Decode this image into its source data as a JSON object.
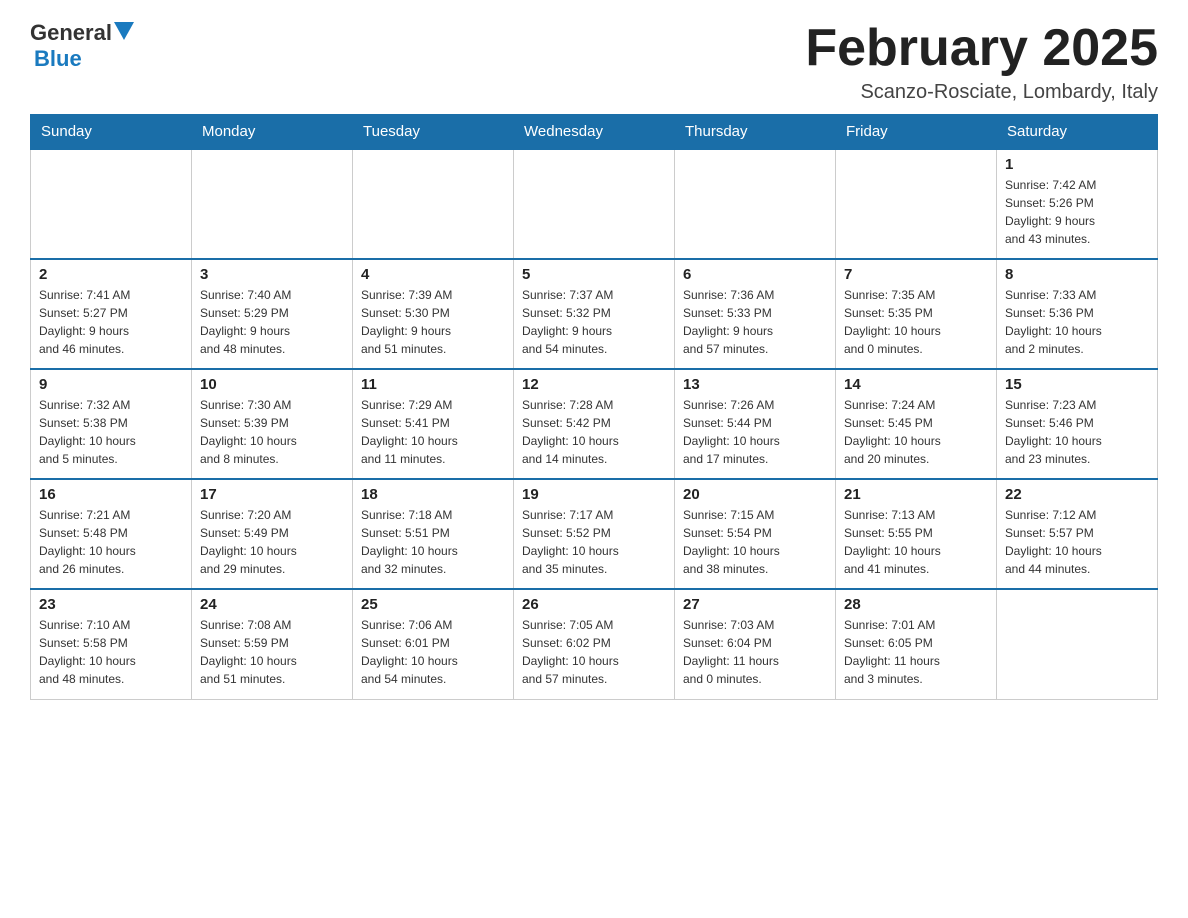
{
  "header": {
    "logo_general": "General",
    "logo_blue": "Blue",
    "month_title": "February 2025",
    "location": "Scanzo-Rosciate, Lombardy, Italy"
  },
  "days_of_week": [
    "Sunday",
    "Monday",
    "Tuesday",
    "Wednesday",
    "Thursday",
    "Friday",
    "Saturday"
  ],
  "weeks": [
    [
      {
        "day": "",
        "info": ""
      },
      {
        "day": "",
        "info": ""
      },
      {
        "day": "",
        "info": ""
      },
      {
        "day": "",
        "info": ""
      },
      {
        "day": "",
        "info": ""
      },
      {
        "day": "",
        "info": ""
      },
      {
        "day": "1",
        "info": "Sunrise: 7:42 AM\nSunset: 5:26 PM\nDaylight: 9 hours\nand 43 minutes."
      }
    ],
    [
      {
        "day": "2",
        "info": "Sunrise: 7:41 AM\nSunset: 5:27 PM\nDaylight: 9 hours\nand 46 minutes."
      },
      {
        "day": "3",
        "info": "Sunrise: 7:40 AM\nSunset: 5:29 PM\nDaylight: 9 hours\nand 48 minutes."
      },
      {
        "day": "4",
        "info": "Sunrise: 7:39 AM\nSunset: 5:30 PM\nDaylight: 9 hours\nand 51 minutes."
      },
      {
        "day": "5",
        "info": "Sunrise: 7:37 AM\nSunset: 5:32 PM\nDaylight: 9 hours\nand 54 minutes."
      },
      {
        "day": "6",
        "info": "Sunrise: 7:36 AM\nSunset: 5:33 PM\nDaylight: 9 hours\nand 57 minutes."
      },
      {
        "day": "7",
        "info": "Sunrise: 7:35 AM\nSunset: 5:35 PM\nDaylight: 10 hours\nand 0 minutes."
      },
      {
        "day": "8",
        "info": "Sunrise: 7:33 AM\nSunset: 5:36 PM\nDaylight: 10 hours\nand 2 minutes."
      }
    ],
    [
      {
        "day": "9",
        "info": "Sunrise: 7:32 AM\nSunset: 5:38 PM\nDaylight: 10 hours\nand 5 minutes."
      },
      {
        "day": "10",
        "info": "Sunrise: 7:30 AM\nSunset: 5:39 PM\nDaylight: 10 hours\nand 8 minutes."
      },
      {
        "day": "11",
        "info": "Sunrise: 7:29 AM\nSunset: 5:41 PM\nDaylight: 10 hours\nand 11 minutes."
      },
      {
        "day": "12",
        "info": "Sunrise: 7:28 AM\nSunset: 5:42 PM\nDaylight: 10 hours\nand 14 minutes."
      },
      {
        "day": "13",
        "info": "Sunrise: 7:26 AM\nSunset: 5:44 PM\nDaylight: 10 hours\nand 17 minutes."
      },
      {
        "day": "14",
        "info": "Sunrise: 7:24 AM\nSunset: 5:45 PM\nDaylight: 10 hours\nand 20 minutes."
      },
      {
        "day": "15",
        "info": "Sunrise: 7:23 AM\nSunset: 5:46 PM\nDaylight: 10 hours\nand 23 minutes."
      }
    ],
    [
      {
        "day": "16",
        "info": "Sunrise: 7:21 AM\nSunset: 5:48 PM\nDaylight: 10 hours\nand 26 minutes."
      },
      {
        "day": "17",
        "info": "Sunrise: 7:20 AM\nSunset: 5:49 PM\nDaylight: 10 hours\nand 29 minutes."
      },
      {
        "day": "18",
        "info": "Sunrise: 7:18 AM\nSunset: 5:51 PM\nDaylight: 10 hours\nand 32 minutes."
      },
      {
        "day": "19",
        "info": "Sunrise: 7:17 AM\nSunset: 5:52 PM\nDaylight: 10 hours\nand 35 minutes."
      },
      {
        "day": "20",
        "info": "Sunrise: 7:15 AM\nSunset: 5:54 PM\nDaylight: 10 hours\nand 38 minutes."
      },
      {
        "day": "21",
        "info": "Sunrise: 7:13 AM\nSunset: 5:55 PM\nDaylight: 10 hours\nand 41 minutes."
      },
      {
        "day": "22",
        "info": "Sunrise: 7:12 AM\nSunset: 5:57 PM\nDaylight: 10 hours\nand 44 minutes."
      }
    ],
    [
      {
        "day": "23",
        "info": "Sunrise: 7:10 AM\nSunset: 5:58 PM\nDaylight: 10 hours\nand 48 minutes."
      },
      {
        "day": "24",
        "info": "Sunrise: 7:08 AM\nSunset: 5:59 PM\nDaylight: 10 hours\nand 51 minutes."
      },
      {
        "day": "25",
        "info": "Sunrise: 7:06 AM\nSunset: 6:01 PM\nDaylight: 10 hours\nand 54 minutes."
      },
      {
        "day": "26",
        "info": "Sunrise: 7:05 AM\nSunset: 6:02 PM\nDaylight: 10 hours\nand 57 minutes."
      },
      {
        "day": "27",
        "info": "Sunrise: 7:03 AM\nSunset: 6:04 PM\nDaylight: 11 hours\nand 0 minutes."
      },
      {
        "day": "28",
        "info": "Sunrise: 7:01 AM\nSunset: 6:05 PM\nDaylight: 11 hours\nand 3 minutes."
      },
      {
        "day": "",
        "info": ""
      }
    ]
  ]
}
